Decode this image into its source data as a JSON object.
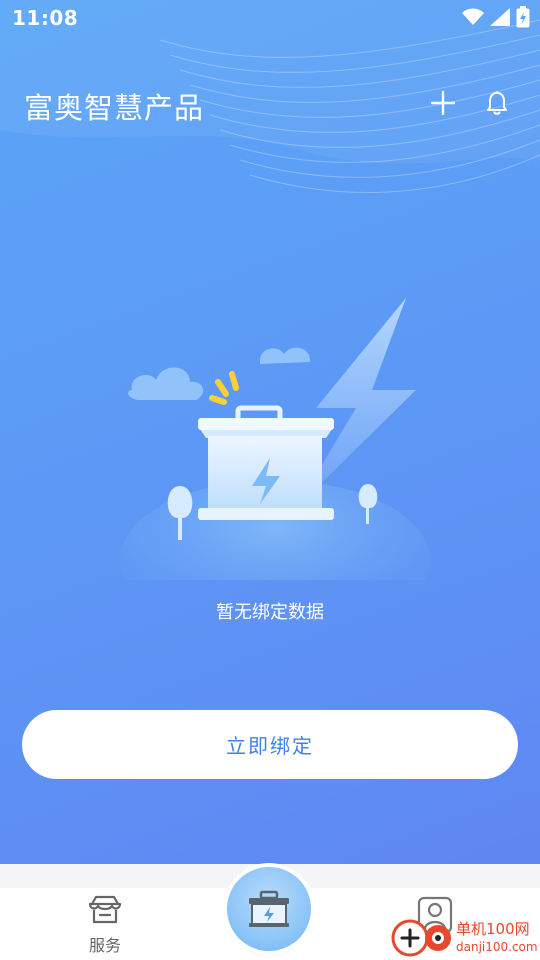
{
  "status_bar": {
    "time": "11:08"
  },
  "header": {
    "title": "富奥智慧产品"
  },
  "empty_state": {
    "message": "暂无绑定数据"
  },
  "bind_button": {
    "label": "立即绑定"
  },
  "tabbar": {
    "service_label": "服务"
  },
  "watermark": {
    "brand": "单机100网",
    "domain": "danji100.com"
  },
  "colors": {
    "primary": "#5c9bf6",
    "button_text": "#3f82ec",
    "background": "#ffffff"
  }
}
